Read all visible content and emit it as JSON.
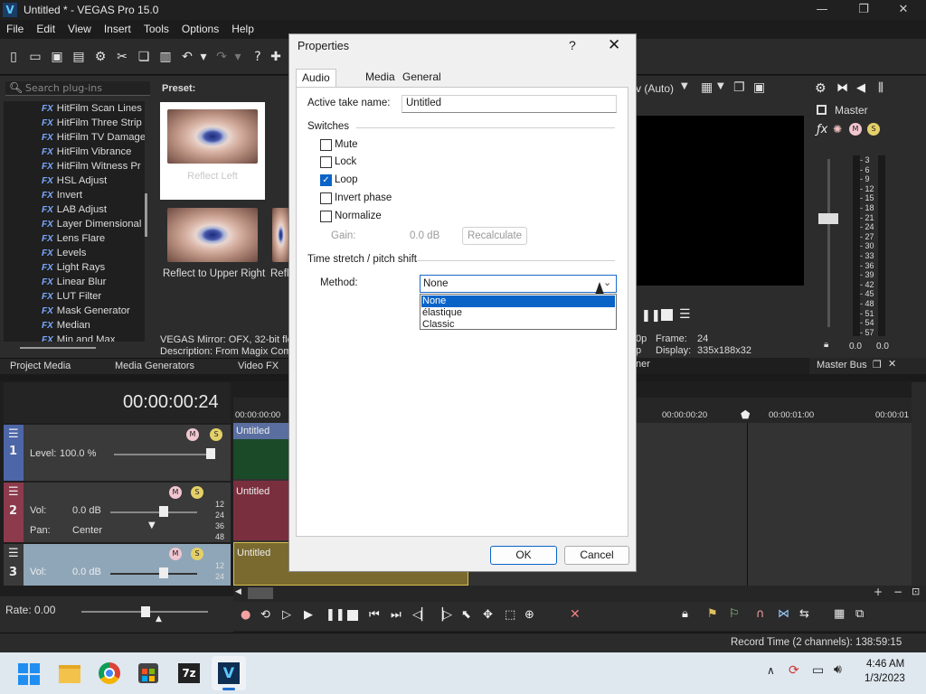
{
  "window": {
    "title": "Untitled * - VEGAS Pro 15.0",
    "logo": "V"
  },
  "menu": [
    "File",
    "Edit",
    "View",
    "Insert",
    "Tools",
    "Options",
    "Help"
  ],
  "plugins": {
    "search_placeholder": "Search plug-ins",
    "preset_label": "Preset:",
    "fx_tag": "FX",
    "items": [
      "HitFilm Scan Lines",
      "HitFilm Three Strip",
      "HitFilm TV Damage",
      "HitFilm Vibrance",
      "HitFilm Witness Pr",
      "HSL Adjust",
      "Invert",
      "LAB Adjust",
      "Layer Dimensional",
      "Lens Flare",
      "Levels",
      "Light Rays",
      "Linear Blur",
      "LUT Filter",
      "Mask Generator",
      "Median",
      "Min and Max"
    ],
    "presets": [
      "Reflect Left",
      "Reflect to Upper Right",
      "Refl"
    ],
    "info_line1": "VEGAS Mirror: OFX, 32-bit floa",
    "info_line2": "Description: From Magix Comp"
  },
  "dock_tabs": [
    "Project Media",
    "Media Generators",
    "Video FX"
  ],
  "preview": {
    "mode": "v (Auto)",
    "frame_label": "Frame:",
    "frame": "24",
    "display_label": "Display:",
    "display": "335x188x32",
    "res_prefix": "0p",
    "row2_prefix": "p",
    "tab_fragment": "ner"
  },
  "master": {
    "label": "Master",
    "bus_tab": "Master Bus",
    "scale": [
      "3",
      "6",
      "9",
      "12",
      "15",
      "18",
      "21",
      "24",
      "27",
      "30",
      "33",
      "36",
      "39",
      "42",
      "45",
      "48",
      "51",
      "54",
      "57"
    ],
    "left_value": "0.0",
    "right_value": "0.0"
  },
  "timeline": {
    "timecode": "00:00:00:24",
    "ruler": [
      "00:00:00:00",
      "00:00:00:20",
      "00:00:01:00",
      "00:00:01"
    ],
    "tracks": [
      {
        "num": "1",
        "label": "Level:",
        "value": "100.0 %",
        "clip": "Untitled"
      },
      {
        "num": "2",
        "vol_label": "Vol:",
        "vol": "0.0 dB",
        "pan_label": "Pan:",
        "pan": "Center",
        "clip": "Untitled"
      },
      {
        "num": "3",
        "vol_label": "Vol:",
        "vol": "0.0 dB",
        "clip": "Untitled"
      }
    ],
    "db_marks": [
      "12",
      "24",
      "36",
      "48"
    ],
    "rate": "Rate: 0.00"
  },
  "status": {
    "record_time": "Record Time (2 channels): 138:59:15"
  },
  "taskbar": {
    "time": "4:46 AM",
    "date": "1/3/2023",
    "sevenzip": "7z",
    "vegas": "V"
  },
  "dialog": {
    "title": "Properties",
    "help": "?",
    "close": "✕",
    "tabs": [
      "Audio Event",
      "Media",
      "General"
    ],
    "active_take_label": "Active take name:",
    "active_take_value": "Untitled",
    "switches_label": "Switches",
    "switches": [
      {
        "label": "Mute",
        "checked": false
      },
      {
        "label": "Lock",
        "checked": false
      },
      {
        "label": "Loop",
        "checked": true
      },
      {
        "label": "Invert phase",
        "checked": false
      },
      {
        "label": "Normalize",
        "checked": false
      }
    ],
    "check_mark": "✓",
    "gain_label": "Gain:",
    "gain_value": "0.0 dB",
    "recalculate": "Recalculate",
    "stretch_label": "Time stretch / pitch shift",
    "method_label": "Method:",
    "method_value": "None",
    "method_options": [
      "None",
      "élastique",
      "Classic"
    ],
    "ok": "OK",
    "cancel": "Cancel"
  }
}
